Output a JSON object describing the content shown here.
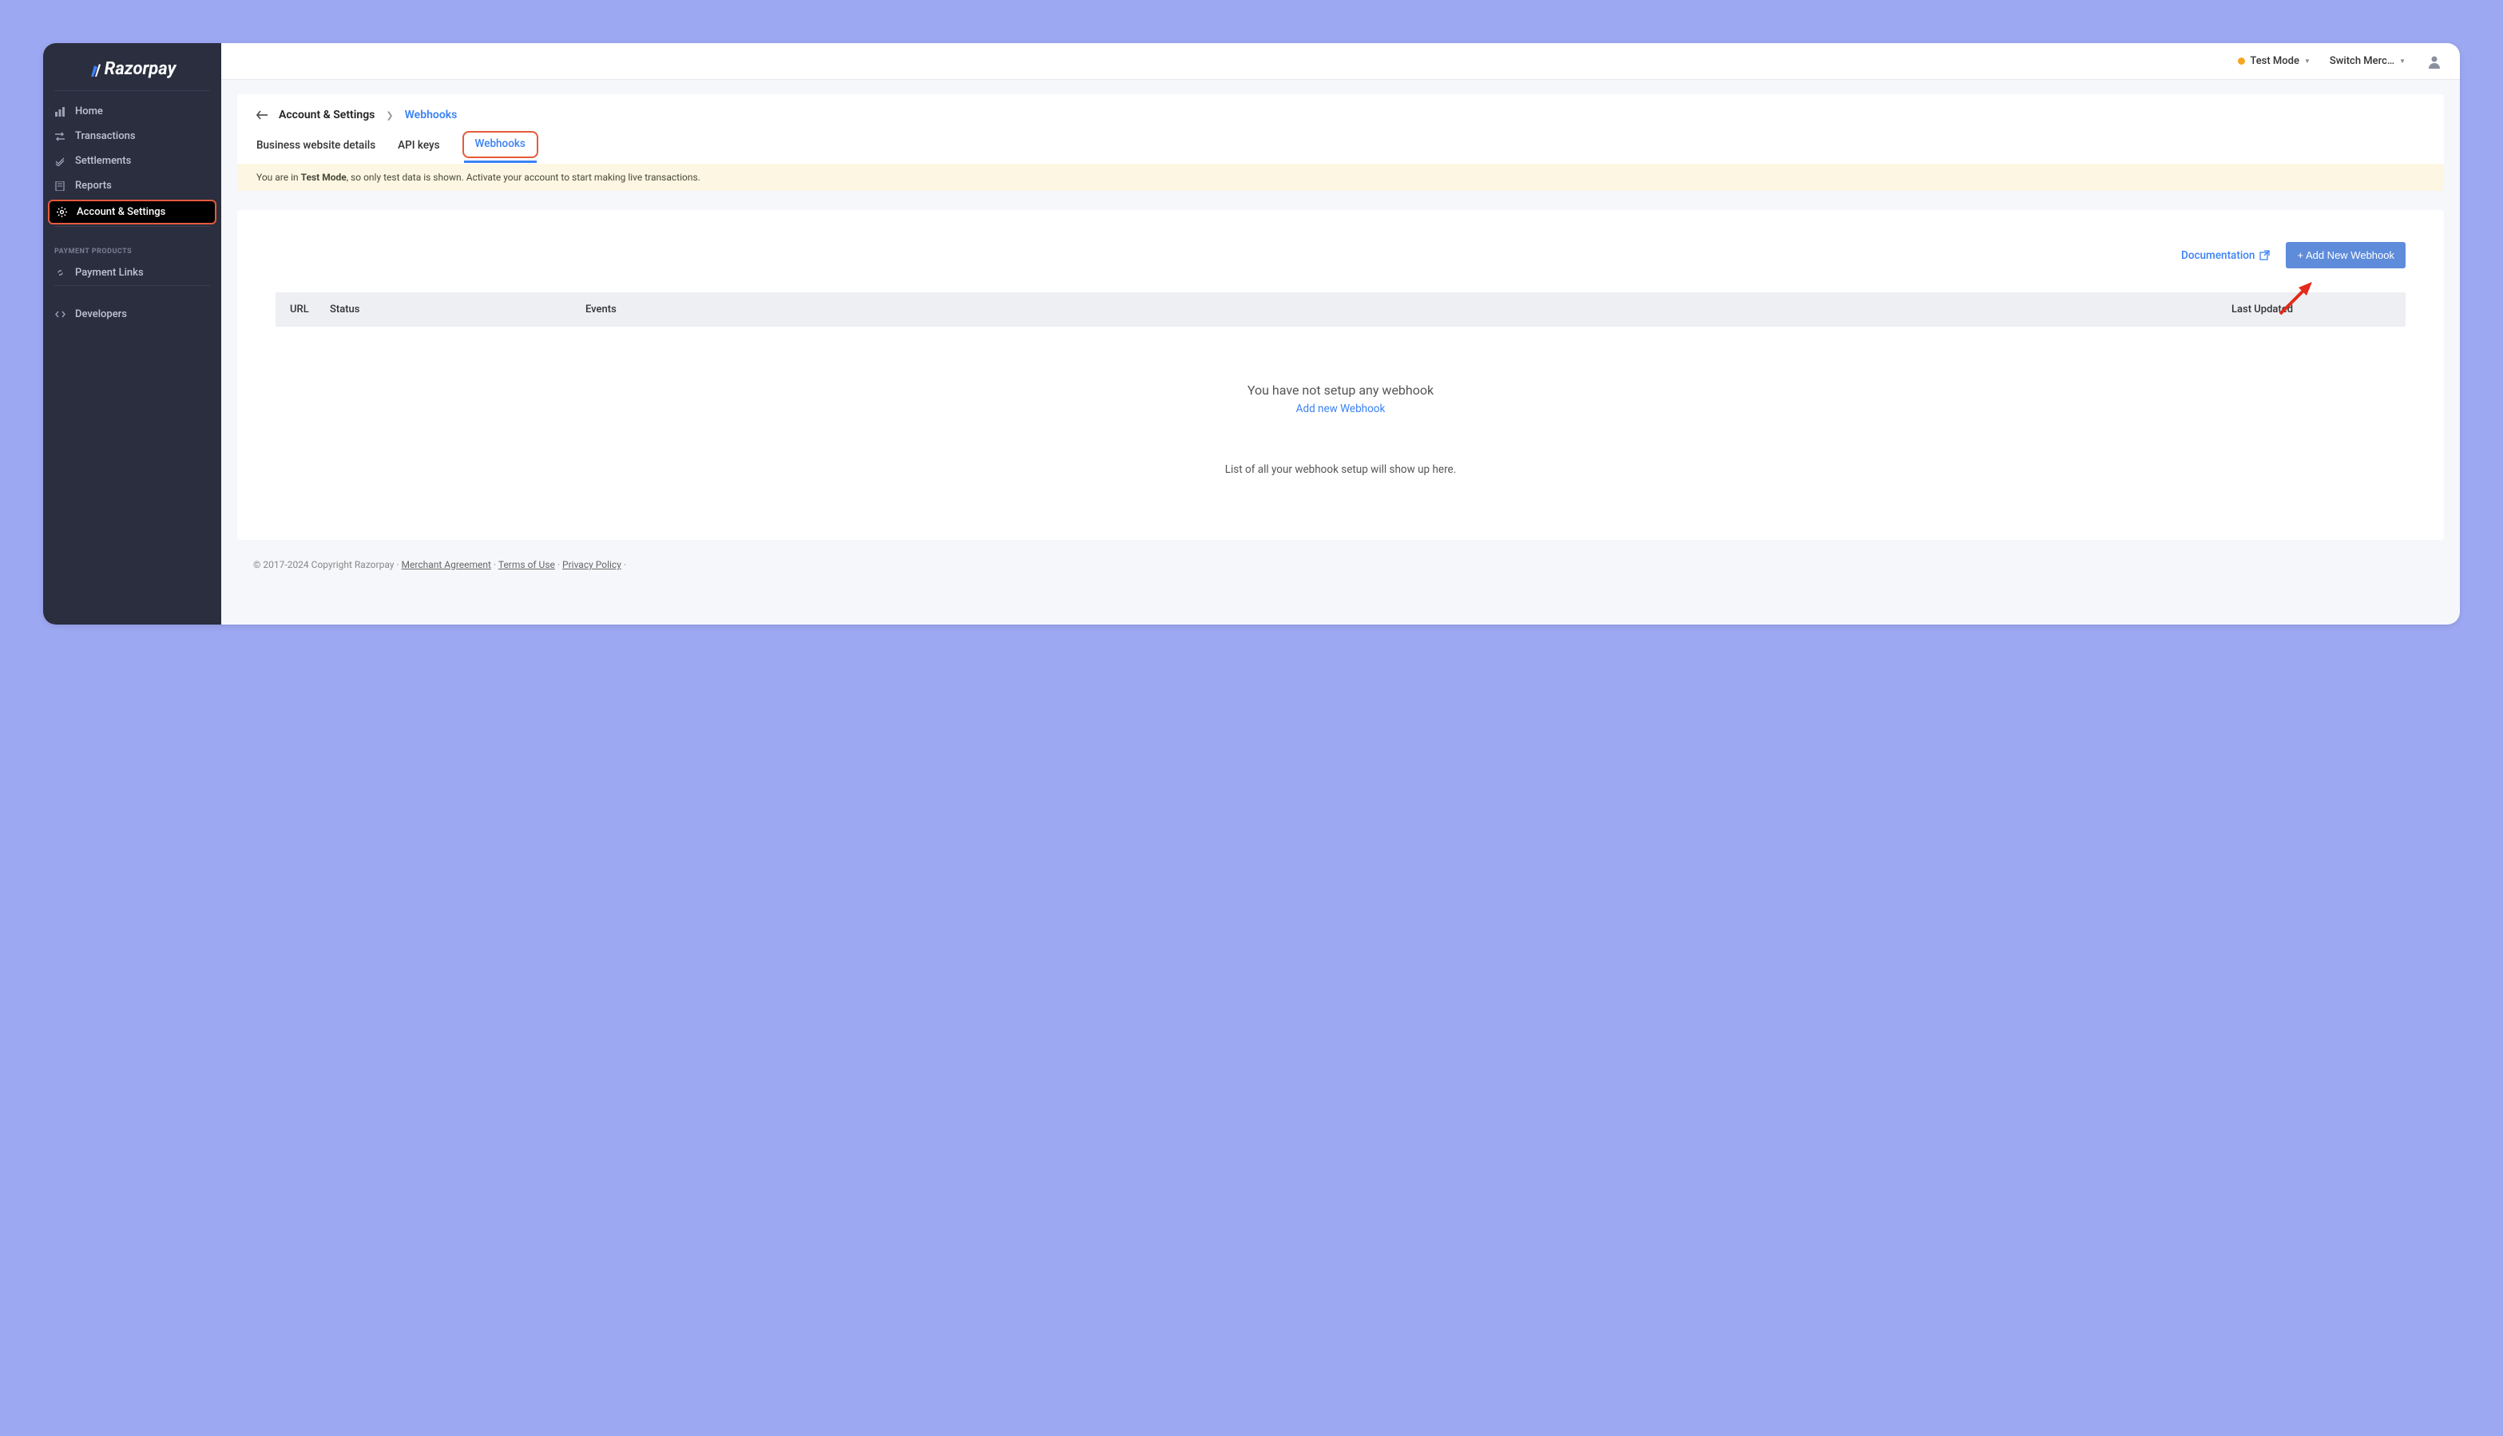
{
  "brand": "Razorpay",
  "sidebar": {
    "items": [
      {
        "label": "Home"
      },
      {
        "label": "Transactions"
      },
      {
        "label": "Settlements"
      },
      {
        "label": "Reports"
      },
      {
        "label": "Account & Settings"
      }
    ],
    "section_label": "PAYMENT PRODUCTS",
    "payment_links": "Payment Links",
    "developers": "Developers"
  },
  "topbar": {
    "mode_label": "Test Mode",
    "switch_label": "Switch Merc…"
  },
  "breadcrumb": {
    "parent": "Account & Settings",
    "current": "Webhooks"
  },
  "tabs": [
    {
      "label": "Business website details"
    },
    {
      "label": "API keys"
    },
    {
      "label": "Webhooks"
    }
  ],
  "banner": {
    "prefix": "You are in ",
    "bold": "Test Mode",
    "suffix": ", so only test data is shown. Activate your account to start making live transactions."
  },
  "actions": {
    "doc_label": "Documentation",
    "add_label": "+ Add New Webhook"
  },
  "table": {
    "headers": {
      "url": "URL",
      "status": "Status",
      "events": "Events",
      "updated": "Last Updated"
    }
  },
  "empty": {
    "title": "You have not setup any webhook",
    "link": "Add new Webhook",
    "subtitle": "List of all your webhook setup will show up here."
  },
  "footer": {
    "copyright": "© 2017-2024 Copyright Razorpay",
    "links": [
      "Merchant Agreement",
      "Terms of Use",
      "Privacy Policy"
    ]
  }
}
